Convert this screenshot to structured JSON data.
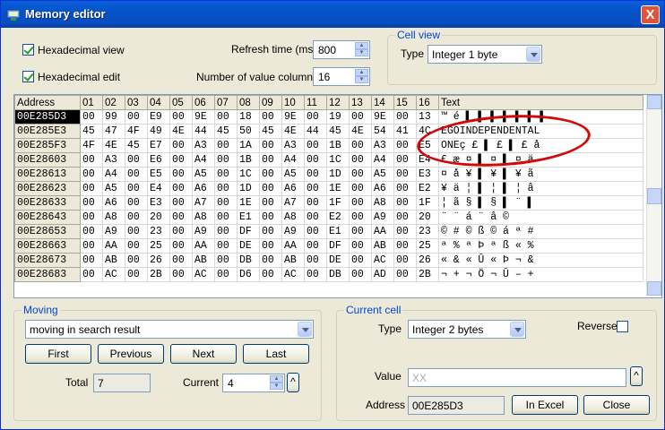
{
  "window": {
    "title": "Memory editor",
    "close_label": "X"
  },
  "options": {
    "hex_view_label": "Hexadecimal view",
    "hex_edit_label": "Hexadecimal edit",
    "refresh_label": "Refresh time (ms)",
    "refresh_value": "800",
    "columns_label": "Number of value columns",
    "columns_value": "16"
  },
  "cell_view": {
    "title": "Cell view",
    "type_label": "Type",
    "type_value": "Integer 1 byte"
  },
  "grid": {
    "headers": [
      "Address",
      "01",
      "02",
      "03",
      "04",
      "05",
      "06",
      "07",
      "08",
      "09",
      "10",
      "11",
      "12",
      "13",
      "14",
      "15",
      "16",
      "Text"
    ],
    "rows": [
      {
        "addr": "00E285D3",
        "cells": [
          "00",
          "99",
          "00",
          "E9",
          "00",
          "9E",
          "00",
          "18",
          "00",
          "9E",
          "00",
          "19",
          "00",
          "9E",
          "00",
          "13"
        ],
        "text": "™ é ▌ ▌ ▌ ▌ ▌ ▌ ▌"
      },
      {
        "addr": "00E285E3",
        "cells": [
          "45",
          "47",
          "4F",
          "49",
          "4E",
          "44",
          "45",
          "50",
          "45",
          "4E",
          "44",
          "45",
          "4E",
          "54",
          "41",
          "4C"
        ],
        "text": "EGOINDEPENDENTAL"
      },
      {
        "addr": "00E285F3",
        "cells": [
          "4F",
          "4E",
          "45",
          "E7",
          "00",
          "A3",
          "00",
          "1A",
          "00",
          "A3",
          "00",
          "1B",
          "00",
          "A3",
          "00",
          "E5"
        ],
        "text": "ONEç £ ▌ £ ▌ £ å"
      },
      {
        "addr": "00E28603",
        "cells": [
          "00",
          "A3",
          "00",
          "E6",
          "00",
          "A4",
          "00",
          "1B",
          "00",
          "A4",
          "00",
          "1C",
          "00",
          "A4",
          "00",
          "E4"
        ],
        "text": "£ æ ¤ ▌ ¤ ▌ ¤ ä"
      },
      {
        "addr": "00E28613",
        "cells": [
          "00",
          "A4",
          "00",
          "E5",
          "00",
          "A5",
          "00",
          "1C",
          "00",
          "A5",
          "00",
          "1D",
          "00",
          "A5",
          "00",
          "E3"
        ],
        "text": "¤ å ¥ ▌ ¥ ▌ ¥ ã"
      },
      {
        "addr": "00E28623",
        "cells": [
          "00",
          "A5",
          "00",
          "E4",
          "00",
          "A6",
          "00",
          "1D",
          "00",
          "A6",
          "00",
          "1E",
          "00",
          "A6",
          "00",
          "E2"
        ],
        "text": "¥ ä ¦ ▌ ¦ ▌ ¦ â"
      },
      {
        "addr": "00E28633",
        "cells": [
          "00",
          "A6",
          "00",
          "E3",
          "00",
          "A7",
          "00",
          "1E",
          "00",
          "A7",
          "00",
          "1F",
          "00",
          "A8",
          "00",
          "1F"
        ],
        "text": "¦ ã § ▌ § ▌ ¨ ▌"
      },
      {
        "addr": "00E28643",
        "cells": [
          "00",
          "A8",
          "00",
          "20",
          "00",
          "A8",
          "00",
          "E1",
          "00",
          "A8",
          "00",
          "E2",
          "00",
          "A9",
          "00",
          "20"
        ],
        "text": "¨   ¨ á ¨ â ©  "
      },
      {
        "addr": "00E28653",
        "cells": [
          "00",
          "A9",
          "00",
          "23",
          "00",
          "A9",
          "00",
          "DF",
          "00",
          "A9",
          "00",
          "E1",
          "00",
          "AA",
          "00",
          "23"
        ],
        "text": "© # © ß © á ª #"
      },
      {
        "addr": "00E28663",
        "cells": [
          "00",
          "AA",
          "00",
          "25",
          "00",
          "AA",
          "00",
          "DE",
          "00",
          "AA",
          "00",
          "DF",
          "00",
          "AB",
          "00",
          "25"
        ],
        "text": "ª % ª Þ ª ß « %"
      },
      {
        "addr": "00E28673",
        "cells": [
          "00",
          "AB",
          "00",
          "26",
          "00",
          "AB",
          "00",
          "DB",
          "00",
          "AB",
          "00",
          "DE",
          "00",
          "AC",
          "00",
          "26"
        ],
        "text": "« & « Û « Þ ¬ &"
      },
      {
        "addr": "00E28683",
        "cells": [
          "00",
          "AC",
          "00",
          "2B",
          "00",
          "AC",
          "00",
          "D6",
          "00",
          "AC",
          "00",
          "DB",
          "00",
          "AD",
          "00",
          "2B"
        ],
        "text": "¬ + ¬ Ö ¬ Û – +"
      }
    ]
  },
  "moving": {
    "title": "Moving",
    "mode_value": "moving in search result",
    "first_label": "First",
    "previous_label": "Previous",
    "next_label": "Next",
    "last_label": "Last",
    "total_label": "Total",
    "total_value": "7",
    "current_label": "Current",
    "current_value": "4"
  },
  "current_cell": {
    "title": "Current cell",
    "type_label": "Type",
    "type_value": "Integer 2 bytes",
    "reverse_label": "Reverse",
    "value_label": "Value",
    "value_value": "XX",
    "address_label": "Address",
    "address_value": "00E285D3",
    "excel_label": "In Excel",
    "close_label": "Close"
  },
  "colors": {
    "title_bar": "#0453c9",
    "highlight_ellipse": "#d00a0a",
    "group_title": "#0046d5"
  }
}
